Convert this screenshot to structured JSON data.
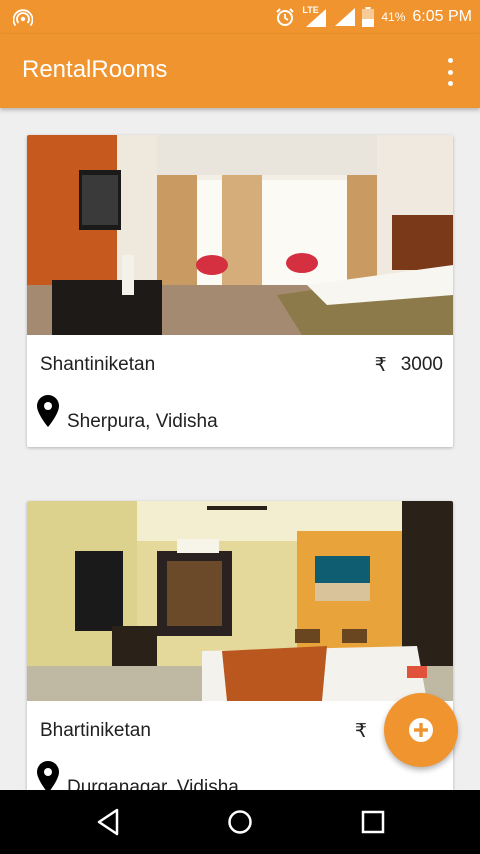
{
  "status_bar": {
    "network": "LTE",
    "battery": "41%",
    "time": "6:05 PM",
    "icons": [
      "hotspot-icon",
      "alarm-icon",
      "signal-icon",
      "signal-icon",
      "battery-icon"
    ]
  },
  "toolbar": {
    "title": "RentalRooms",
    "menu_icon": "more-vert-icon"
  },
  "rooms": [
    {
      "name": "Shantiniketan",
      "currency": "₹",
      "price": "3000",
      "location": "Sherpura, Vidisha"
    },
    {
      "name": "Bhartiniketan",
      "currency": "₹",
      "price": "",
      "location": "Durganagar, Vidisha"
    }
  ],
  "fab": {
    "icon": "add-circle-icon"
  },
  "nav": {
    "icons": [
      "back-icon",
      "home-icon",
      "recents-icon"
    ]
  },
  "colors": {
    "primary": "#f0942f",
    "background": "#efefef"
  }
}
